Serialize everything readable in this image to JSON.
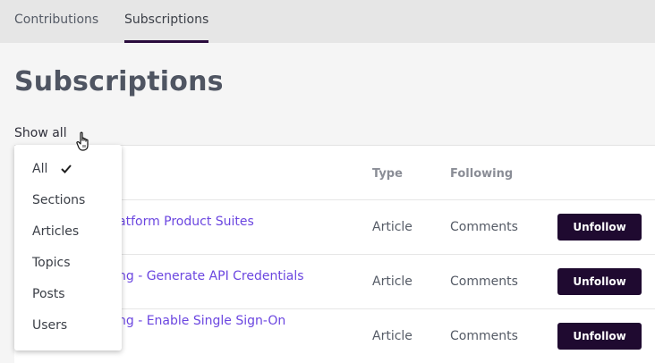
{
  "tabs": {
    "contributions": "Contributions",
    "subscriptions": "Subscriptions"
  },
  "page_title": "Subscriptions",
  "filter": {
    "label": "Show all"
  },
  "table": {
    "headers": {
      "type": "Type",
      "following": "Following"
    },
    "rows": [
      {
        "title_visible": "atform Product Suites",
        "type": "Article",
        "following": "Comments",
        "action": "Unfollow"
      },
      {
        "title_visible": "ng - Generate API Credentials",
        "type": "Article",
        "following": "Comments",
        "action": "Unfollow"
      },
      {
        "title_visible": "ng - Enable Single Sign-On",
        "type": "Article",
        "following": "Comments",
        "action": "Unfollow"
      }
    ]
  },
  "dropdown": {
    "selected": "All",
    "options": [
      "All",
      "Sections",
      "Articles",
      "Topics",
      "Posts",
      "Users"
    ]
  },
  "colors": {
    "accent_dark": "#1f0a30",
    "link": "#6b46e0",
    "tab_underline": "#2a0b3d"
  }
}
